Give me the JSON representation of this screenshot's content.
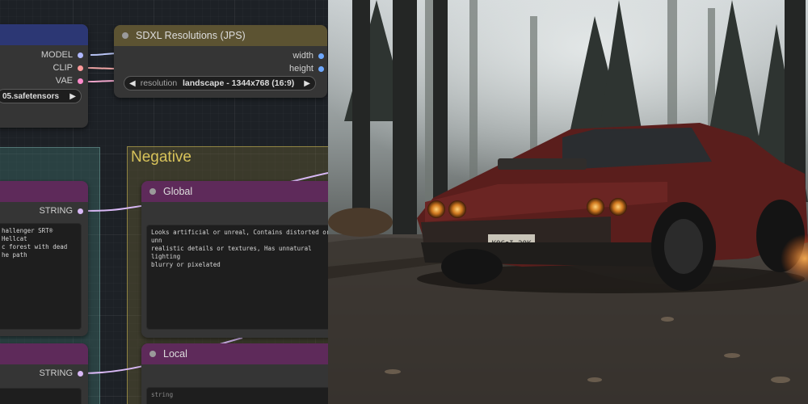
{
  "loader": {
    "outputs": [
      "MODEL",
      "CLIP",
      "VAE"
    ],
    "ckpt_value": "05.safetensors"
  },
  "resolutions": {
    "title": "SDXL Resolutions (JPS)",
    "outputs": [
      "width",
      "height"
    ],
    "widget_label": "resolution",
    "widget_value": "landscape - 1344x768 (16:9)"
  },
  "group_negative": {
    "title": "Negative"
  },
  "pos_global": {
    "output": "STRING",
    "text": "hallenger SRT® Hellcat\nc forest with dead\nhe path"
  },
  "pos_local": {
    "output": "STRING"
  },
  "neg_global": {
    "title": "Global",
    "text": "Looks artificial or unreal, Contains distorted or unn\nrealistic details or textures, Has unnatural lighting\nblurry or pixelated"
  },
  "neg_local": {
    "title": "Local",
    "placeholder": "string"
  },
  "preview": {
    "plate": "KOC●I 20K"
  },
  "colors": {
    "model": "#b0b8ff",
    "clip": "#ffd500",
    "vae": "#ff6e6e",
    "string": "#a0e6a0",
    "int": "#6ea8ff"
  }
}
